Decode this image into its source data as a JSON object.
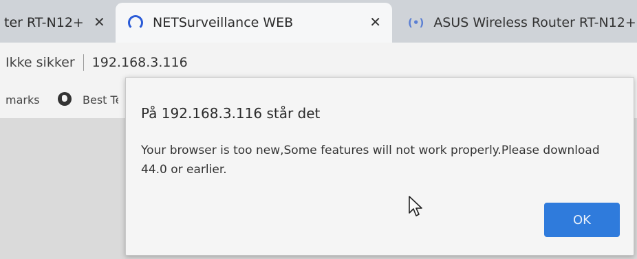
{
  "tabs": [
    {
      "title": "ter RT-N12+",
      "close": "✕"
    },
    {
      "title": "NETSurveillance WEB",
      "close": "✕"
    },
    {
      "title": "ASUS Wireless Router RT-N12+"
    }
  ],
  "address": {
    "security": "Ikke sikker",
    "url": "192.168.3.116"
  },
  "bookmarks": [
    "marks",
    "Best Te"
  ],
  "dialog": {
    "title": "På 192.168.3.116 står det",
    "message": "Your browser is too new,Some features will not work properly.Please download 44.0 or earlier.",
    "ok_label": "OK"
  },
  "colors": {
    "accent": "#2f7bdc"
  }
}
